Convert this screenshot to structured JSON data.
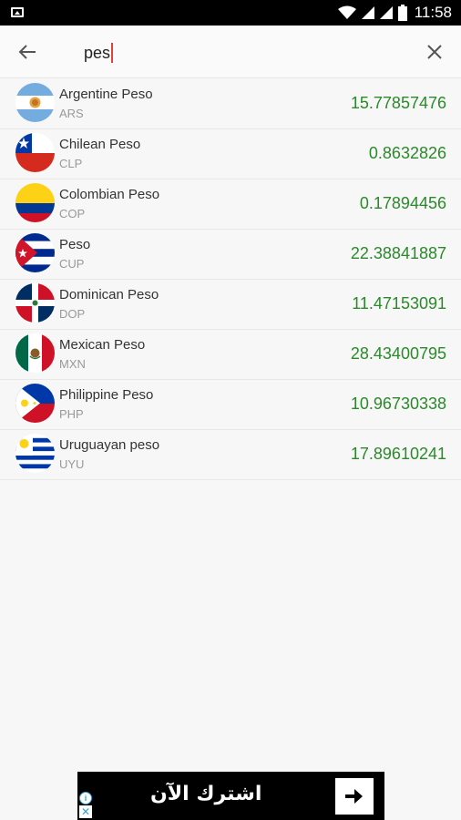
{
  "status_bar": {
    "time": "11:58",
    "icons": [
      "image-icon",
      "wifi-icon",
      "signal-icon",
      "signal-icon",
      "battery-icon"
    ]
  },
  "search": {
    "value": "pes",
    "back_icon": "arrow-left-icon",
    "clear_icon": "close-icon"
  },
  "currencies": [
    {
      "name": "Argentine Peso",
      "code": "ARS",
      "rate": "15.77857476",
      "flag": "argentina-flag"
    },
    {
      "name": "Chilean Peso",
      "code": "CLP",
      "rate": "0.8632826",
      "flag": "chile-flag"
    },
    {
      "name": "Colombian Peso",
      "code": "COP",
      "rate": "0.17894456",
      "flag": "colombia-flag"
    },
    {
      "name": "Peso",
      "code": "CUP",
      "rate": "22.38841887",
      "flag": "cuba-flag"
    },
    {
      "name": "Dominican Peso",
      "code": "DOP",
      "rate": "11.47153091",
      "flag": "dominican-republic-flag"
    },
    {
      "name": "Mexican Peso",
      "code": "MXN",
      "rate": "28.43400795",
      "flag": "mexico-flag"
    },
    {
      "name": "Philippine Peso",
      "code": "PHP",
      "rate": "10.96730338",
      "flag": "philippines-flag"
    },
    {
      "name": "Uruguayan peso",
      "code": "UYU",
      "rate": "17.89610241",
      "flag": "uruguay-flag"
    }
  ],
  "ad": {
    "text": "اشترك الآن",
    "arrow_icon": "arrow-right-icon"
  },
  "colors": {
    "rate_green": "#2a8a2a",
    "caret_red": "#e04040",
    "status_bar": "#000000"
  }
}
